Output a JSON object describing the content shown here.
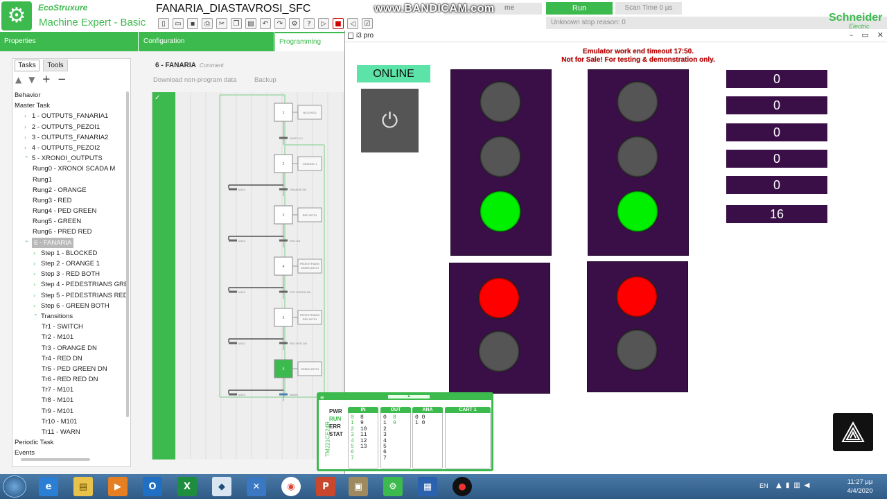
{
  "header": {
    "brand_eco": "EcoStruxure",
    "brand_product": "Machine Expert - Basic",
    "project_title": "FANARIA_DIASTAVROSI_SFC",
    "watermark": "www.BANDICAM.com",
    "mode_text": "me",
    "run_label": "Run",
    "scan_time": "Scan Time 0 µs",
    "stop_reason": "Unknown stop reason: 0",
    "vendor": "Schneider",
    "vendor_sub": "Electric"
  },
  "main_tabs": {
    "properties": "Properties",
    "configuration": "Configuration",
    "programming": "Programming"
  },
  "left_panel": {
    "tab_tasks": "Tasks",
    "tab_tools": "Tools",
    "tree": [
      {
        "label": "Behavior",
        "indent": 0,
        "chev": ""
      },
      {
        "label": "Master Task",
        "indent": 0,
        "chev": "^"
      },
      {
        "label": "1 - OUTPUTS_FANARIA1",
        "indent": 1,
        "chev": ">"
      },
      {
        "label": "2 - OUTPUTS_PEZOI1",
        "indent": 1,
        "chev": ">"
      },
      {
        "label": "3 - OUTPUTS_FANARIA2",
        "indent": 1,
        "chev": ">"
      },
      {
        "label": "4 - OUTPUTS_PEZOI2",
        "indent": 1,
        "chev": ">"
      },
      {
        "label": "5 - XRONOI_OUTPUTS",
        "indent": 1,
        "chev": "^"
      },
      {
        "label": "Rung0 - XRONOI SCADA M",
        "indent": 2,
        "chev": ""
      },
      {
        "label": "Rung1",
        "indent": 2,
        "chev": ""
      },
      {
        "label": "Rung2 - ORANGE",
        "indent": 2,
        "chev": ""
      },
      {
        "label": "Rung3 - RED",
        "indent": 2,
        "chev": ""
      },
      {
        "label": "Rung4 - PED GREEN",
        "indent": 2,
        "chev": ""
      },
      {
        "label": "Rung5 - GREEN",
        "indent": 2,
        "chev": ""
      },
      {
        "label": "Rung6 - PRED RED",
        "indent": 2,
        "chev": ""
      },
      {
        "label": "6 - FANARIA",
        "indent": 1,
        "chev": "^",
        "selected": true
      },
      {
        "label": "Step 1 - BLOCKED",
        "indent": 2,
        "chev": ">"
      },
      {
        "label": "Step 2 - ORANGE 1",
        "indent": 2,
        "chev": ">"
      },
      {
        "label": "Step 3 - RED BOTH",
        "indent": 2,
        "chev": ">"
      },
      {
        "label": "Step 4 - PEDESTRIANS GRE",
        "indent": 2,
        "chev": ">"
      },
      {
        "label": "Step 5 - PEDESTRIANS RED",
        "indent": 2,
        "chev": ">"
      },
      {
        "label": "Step 6 - GREEN BOTH",
        "indent": 2,
        "chev": ">"
      },
      {
        "label": "Transitions",
        "indent": 2,
        "chev": "^"
      },
      {
        "label": "Tr1 - SWITCH",
        "indent": 3,
        "chev": ""
      },
      {
        "label": "Tr2 - M101",
        "indent": 3,
        "chev": ""
      },
      {
        "label": "Tr3 - ORANGE DN",
        "indent": 3,
        "chev": ""
      },
      {
        "label": "Tr4 - RED DN",
        "indent": 3,
        "chev": ""
      },
      {
        "label": "Tr5 - PED GREEN DN",
        "indent": 3,
        "chev": ""
      },
      {
        "label": "Tr6 - RED RED DN",
        "indent": 3,
        "chev": ""
      },
      {
        "label": "Tr7 - M101",
        "indent": 3,
        "chev": ""
      },
      {
        "label": "Tr8 - M101",
        "indent": 3,
        "chev": ""
      },
      {
        "label": "Tr9 - M101",
        "indent": 3,
        "chev": ""
      },
      {
        "label": "Tr10 - M101",
        "indent": 3,
        "chev": ""
      },
      {
        "label": "Tr11 - WARN",
        "indent": 3,
        "chev": ""
      },
      {
        "label": "Periodic Task",
        "indent": 0,
        "chev": ""
      },
      {
        "label": "Events",
        "indent": 0,
        "chev": ""
      }
    ]
  },
  "editor": {
    "pou_title": "6 - FANARIA",
    "comment_label": "Comment",
    "download_label": "Download non-program data",
    "backup_label": "Backup",
    "steps": [
      {
        "num": "1",
        "action": "BLOCKED",
        "active": false
      },
      {
        "num": "2",
        "action": "ORANGE 1",
        "active": false
      },
      {
        "num": "3",
        "action": "RED BOTH",
        "active": false
      },
      {
        "num": "4",
        "action": "PEDESTRIANS GREEN BOTH",
        "active": false
      },
      {
        "num": "5",
        "action": "PEDESTRIANS RED BOTH",
        "active": false
      },
      {
        "num": "6",
        "action": "GREEN BOTH",
        "active": true
      }
    ],
    "transitions": [
      {
        "left": "",
        "right": "SWITCH 1",
        "highlight": false
      },
      {
        "left": "M101",
        "right": "ORANGE DN",
        "highlight": false
      },
      {
        "left": "M101",
        "right": "RED DN",
        "highlight": false
      },
      {
        "left": "M101",
        "right": "PED GREEN DN",
        "highlight": false
      },
      {
        "left": "M101",
        "right": "RED RED DN",
        "highlight": false
      },
      {
        "left": "M101",
        "right": "WARN",
        "highlight": true
      }
    ]
  },
  "hmi": {
    "window_title": "i3 pro",
    "emulator_line1": "Emulator work end timeout 17:50.",
    "emulator_line2": "Not for Sale! For testing & demonstration only.",
    "online_label": "ONLINE",
    "colors": {
      "green": "#00f000",
      "red": "#ff0000",
      "off": "#555555",
      "panel": "#3a0f48"
    },
    "lights": {
      "traffic_1": [
        "off",
        "off",
        "green"
      ],
      "traffic_2": [
        "off",
        "off",
        "green"
      ],
      "pedestrian_1": [
        "red",
        "off"
      ],
      "pedestrian_2": [
        "red",
        "off"
      ]
    },
    "counters": [
      "0",
      "0",
      "0",
      "0",
      "0",
      "16"
    ]
  },
  "plc_status": {
    "model": "TM221CE24R",
    "pwr": "PWR",
    "run": "RUN",
    "err": "ERR",
    "stat": "STAT",
    "in_header": "IN",
    "out_header": "OUT",
    "ana_header": "ANA",
    "cart_header": "CART 1",
    "in_col1": "0\n1\n2\n3\n4\n5\n6\n7",
    "in_col2": "8\n9\n10\n11\n12\n13",
    "out_col1": "0\n1\n2\n3\n4\n5\n6\n7",
    "out_col2": "8\n9",
    "ana_col": "0 0\n1 0"
  },
  "taskbar": {
    "lang": "EN",
    "time": "11:27 μμ",
    "date": "4/4/2020"
  }
}
